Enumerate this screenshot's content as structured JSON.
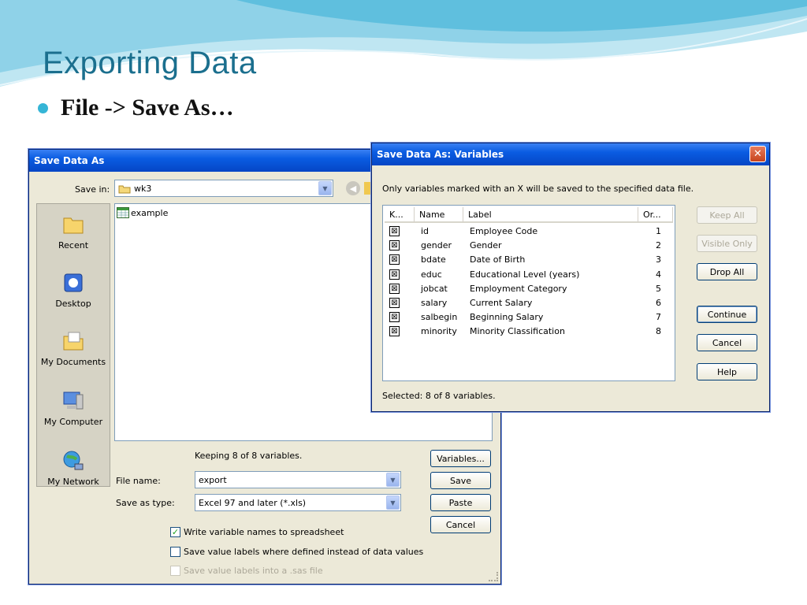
{
  "slide": {
    "title": "Exporting Data",
    "bullet": "File  ->  Save As…"
  },
  "save_dialog": {
    "title": "Save Data As",
    "save_in_label": "Save in:",
    "save_in_value": "wk3",
    "places": [
      "Recent",
      "Desktop",
      "My Documents",
      "My Computer",
      "My Network"
    ],
    "files": [
      "example"
    ],
    "keeping_text": "Keeping 8 of 8 variables.",
    "file_name_label": "File name:",
    "file_name_value": "export",
    "save_type_label": "Save as type:",
    "save_type_value": "Excel 97 and later (*.xls)",
    "buttons": {
      "variables": "Variables...",
      "save": "Save",
      "paste": "Paste",
      "cancel": "Cancel"
    },
    "checkboxes": [
      {
        "label": "Write variable names to spreadsheet",
        "checked": true,
        "enabled": true
      },
      {
        "label": "Save value labels where defined instead of data values",
        "checked": false,
        "enabled": true
      },
      {
        "label": "Save value labels into a .sas file",
        "checked": false,
        "enabled": false
      }
    ]
  },
  "variables_dialog": {
    "title": "Save Data As:  Variables",
    "instruction": "Only variables marked with an X will be saved to the specified data file.",
    "columns": [
      "K...",
      "Name",
      "Label",
      "Or..."
    ],
    "rows": [
      {
        "keep": "⊠",
        "name": "id",
        "label": "Employee Code",
        "order": "1"
      },
      {
        "keep": "⊠",
        "name": "gender",
        "label": "Gender",
        "order": "2"
      },
      {
        "keep": "⊠",
        "name": "bdate",
        "label": "Date of Birth",
        "order": "3"
      },
      {
        "keep": "⊠",
        "name": "educ",
        "label": "Educational Level (years)",
        "order": "4"
      },
      {
        "keep": "⊠",
        "name": "jobcat",
        "label": "Employment Category",
        "order": "5"
      },
      {
        "keep": "⊠",
        "name": "salary",
        "label": "Current Salary",
        "order": "6"
      },
      {
        "keep": "⊠",
        "name": "salbegin",
        "label": "Beginning Salary",
        "order": "7"
      },
      {
        "keep": "⊠",
        "name": "minority",
        "label": "Minority Classification",
        "order": "8"
      }
    ],
    "selected_text": "Selected: 8 of 8 variables.",
    "buttons": {
      "keep_all": "Keep All",
      "visible_only": "Visible Only",
      "drop_all": "Drop All",
      "continue": "Continue",
      "cancel": "Cancel",
      "help": "Help"
    },
    "close_glyph": "✕"
  },
  "colors": {
    "title_blue": "#1b6f8e",
    "bullet": "#35b5d6",
    "xp_title": "#0a5ce2"
  }
}
